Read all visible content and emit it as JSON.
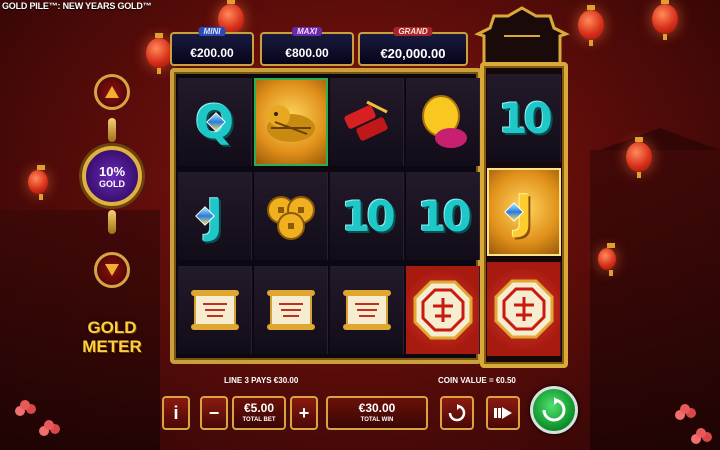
{
  "title": "GOLD PILE™: NEW YEARS GOLD™",
  "jackpots": [
    {
      "label": "MINI",
      "value": "€200.00"
    },
    {
      "label": "MAXI",
      "value": "€800.00"
    },
    {
      "label": "GRAND",
      "value": "€20,000.00"
    }
  ],
  "gold_meter": {
    "percent": "10%",
    "word": "GOLD",
    "label": "GOLD METER",
    "up_icon": "triangle-up-icon",
    "down_icon": "triangle-down-icon"
  },
  "reels": [
    [
      "Q",
      "golden-tiger",
      "J-gem",
      "coins",
      "scroll",
      "scroll"
    ],
    [
      "firecracker",
      "10",
      "scroll",
      "gold-ingot",
      "10",
      "red-lucky-symbol"
    ]
  ],
  "bonus_reel": [
    "10",
    "J-gem",
    "red-lucky-symbol"
  ],
  "info": {
    "line_pays": "LINE 3 PAYS €30.00",
    "coin_value": "COIN VALUE = €0.50"
  },
  "controls": {
    "info_button": "i",
    "minus_button": "−",
    "plus_button": "+",
    "total_bet_value": "€5.00",
    "total_bet_label": "TOTAL BET",
    "total_win_value": "€30.00",
    "total_win_label": "TOTAL WIN"
  },
  "colors": {
    "gold": "#c9a03a",
    "cyan": "#1ec8c8",
    "spin_green": "#139a30"
  }
}
